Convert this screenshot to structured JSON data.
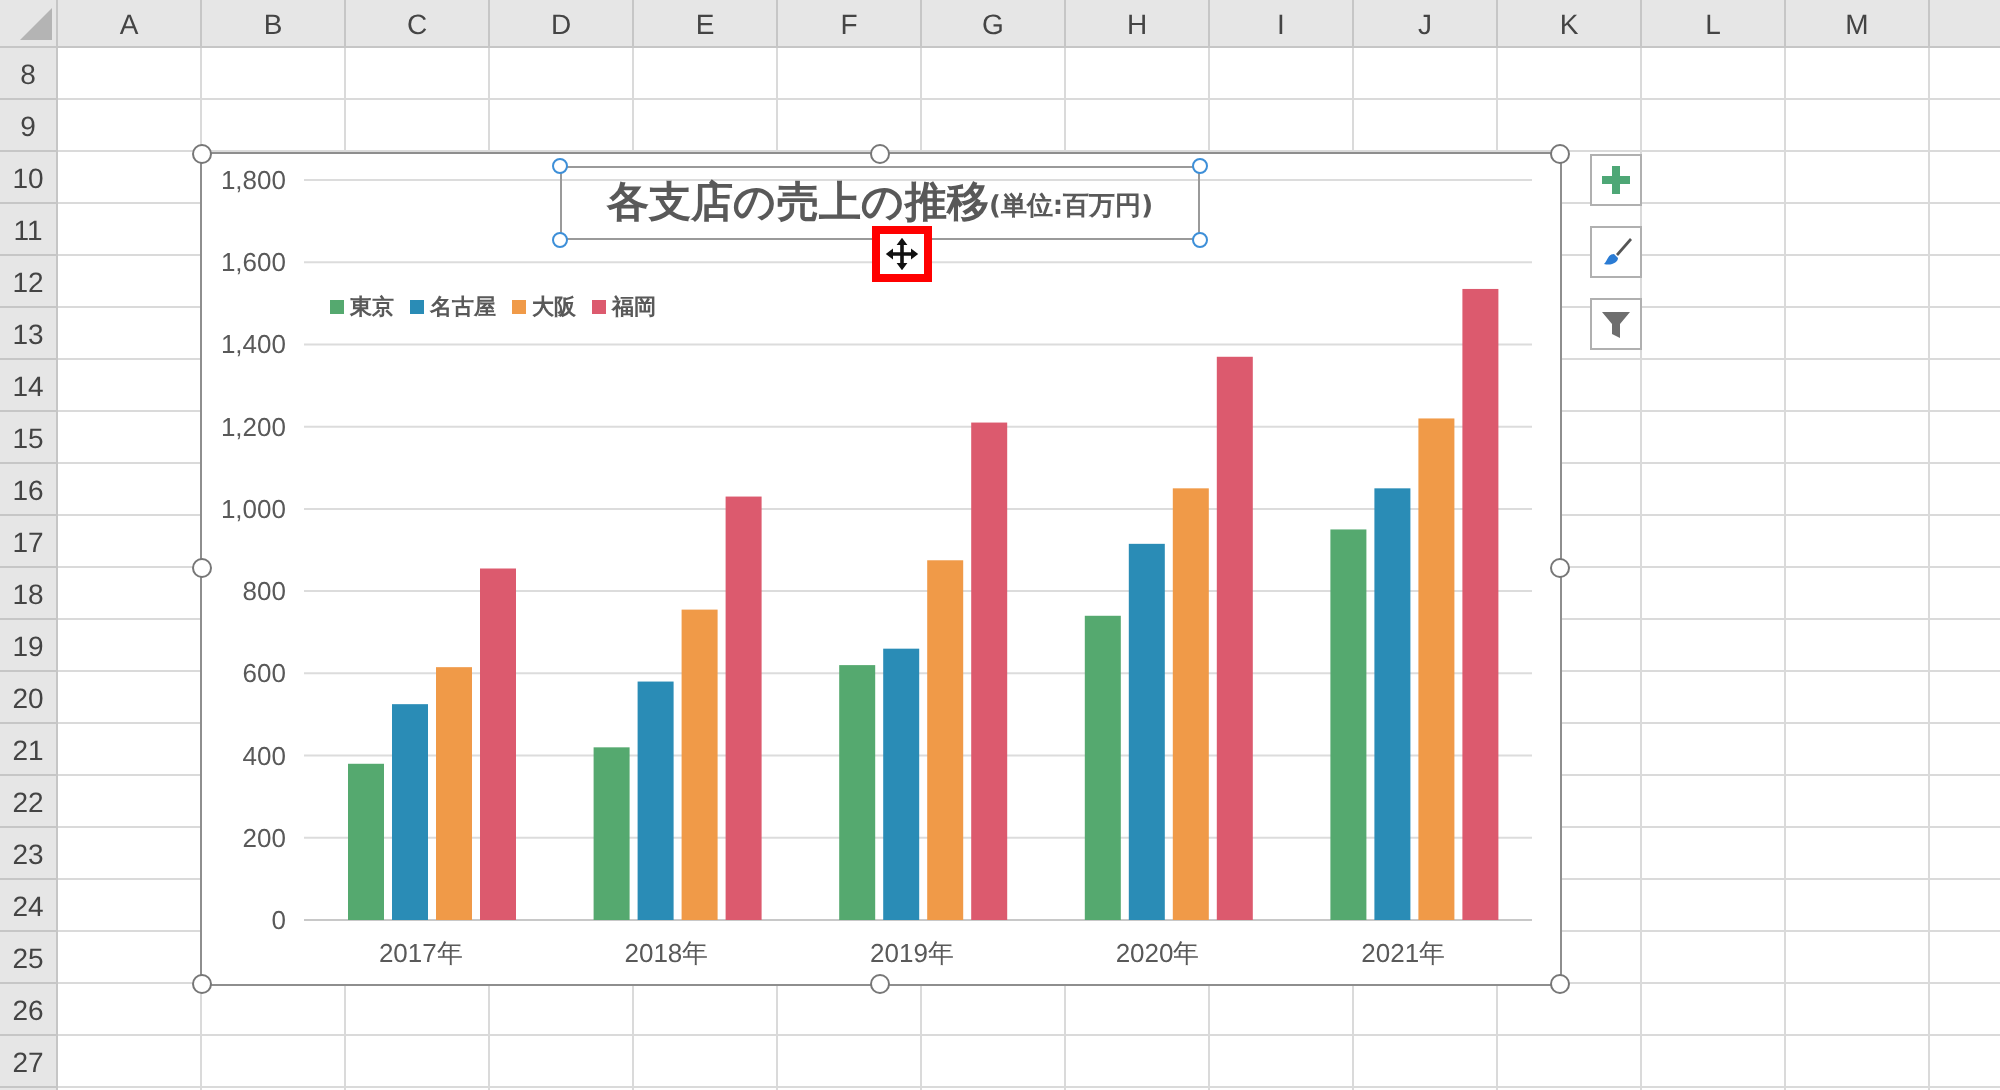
{
  "sheet": {
    "columns": [
      "A",
      "B",
      "C",
      "D",
      "E",
      "F",
      "G",
      "H",
      "I",
      "J",
      "K",
      "L",
      "M"
    ],
    "rows": [
      "8",
      "9",
      "10",
      "11",
      "12",
      "13",
      "14",
      "15",
      "16",
      "17",
      "18",
      "19",
      "20",
      "21",
      "22",
      "23",
      "24",
      "25",
      "26",
      "27"
    ]
  },
  "chart": {
    "title": "各支店の売上の推移",
    "title_suffix": "(単位:百万円)",
    "selected": true,
    "title_selected": true,
    "chart_data": {
      "type": "bar",
      "categories": [
        "2017年",
        "2018年",
        "2019年",
        "2020年",
        "2021年"
      ],
      "series": [
        {
          "name": "東京",
          "color": "#55a96f",
          "values": [
            380,
            420,
            620,
            740,
            950
          ]
        },
        {
          "name": "名古屋",
          "color": "#2a8cb6",
          "values": [
            525,
            580,
            660,
            915,
            1050
          ]
        },
        {
          "name": "大阪",
          "color": "#f09a48",
          "values": [
            615,
            755,
            875,
            1050,
            1220
          ]
        },
        {
          "name": "福岡",
          "color": "#dc5a6e",
          "values": [
            855,
            1030,
            1210,
            1370,
            1535
          ]
        }
      ],
      "ylim": [
        0,
        1800
      ],
      "grid": true,
      "yticks": [
        {
          "value": 0,
          "label": "0"
        },
        {
          "value": 200,
          "label": "200"
        },
        {
          "value": 400,
          "label": "400"
        },
        {
          "value": 600,
          "label": "600"
        },
        {
          "value": 800,
          "label": "800"
        },
        {
          "value": 1000,
          "label": "1,000"
        },
        {
          "value": 1200,
          "label": "1,200"
        },
        {
          "value": 1400,
          "label": "1,400"
        },
        {
          "value": 1600,
          "label": "1,600"
        },
        {
          "value": 1800,
          "label": "1,800"
        }
      ]
    }
  },
  "side_buttons": [
    {
      "kind": "plus"
    },
    {
      "kind": "brush"
    },
    {
      "kind": "filter"
    }
  ]
}
